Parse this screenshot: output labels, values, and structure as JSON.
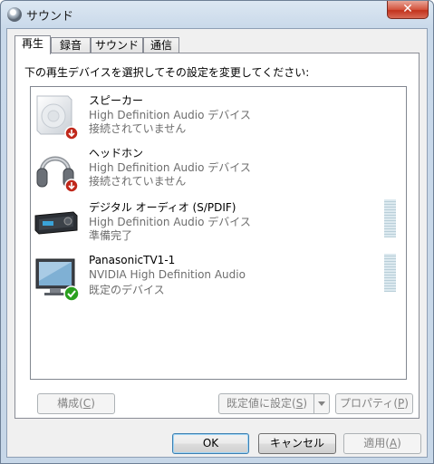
{
  "window": {
    "title": "サウンド",
    "close_label": "✕"
  },
  "tabs": [
    {
      "label": "再生",
      "active": true
    },
    {
      "label": "録音",
      "active": false
    },
    {
      "label": "サウンド",
      "active": false
    },
    {
      "label": "通信",
      "active": false
    }
  ],
  "instruction": "下の再生デバイスを選択してその設定を変更してください:",
  "devices": [
    {
      "name": "スピーカー",
      "description": "High Definition Audio デバイス",
      "status": "接続されていません",
      "icon": "speaker-icon",
      "badge": "disconnected-badge-icon"
    },
    {
      "name": "ヘッドホン",
      "description": "High Definition Audio デバイス",
      "status": "接続されていません",
      "icon": "headphones-icon",
      "badge": "disconnected-badge-icon"
    },
    {
      "name": "デジタル オーディオ (S/PDIF)",
      "description": "High Definition Audio デバイス",
      "status": "準備完了",
      "icon": "digital-audio-receiver-icon",
      "badge": null
    },
    {
      "name": "PanasonicTV1-1",
      "description": "NVIDIA High Definition Audio",
      "status": "既定のデバイス",
      "icon": "monitor-icon",
      "badge": "default-check-badge-icon"
    }
  ],
  "buttons": {
    "configure": {
      "text": "構成(",
      "key": "C",
      "close": ")"
    },
    "set_default": {
      "text": "既定値に設定(",
      "key": "S",
      "close": ")"
    },
    "properties": {
      "text": "プロパティ(",
      "key": "P",
      "close": ")"
    },
    "ok": "OK",
    "cancel": "キャンセル",
    "apply": {
      "text": "適用(",
      "key": "A",
      "close": ")"
    }
  },
  "colors": {
    "accent": "#3c7fb1",
    "close": "#c2321c",
    "check": "#2aa01e",
    "disconnect": "#c0281b"
  }
}
